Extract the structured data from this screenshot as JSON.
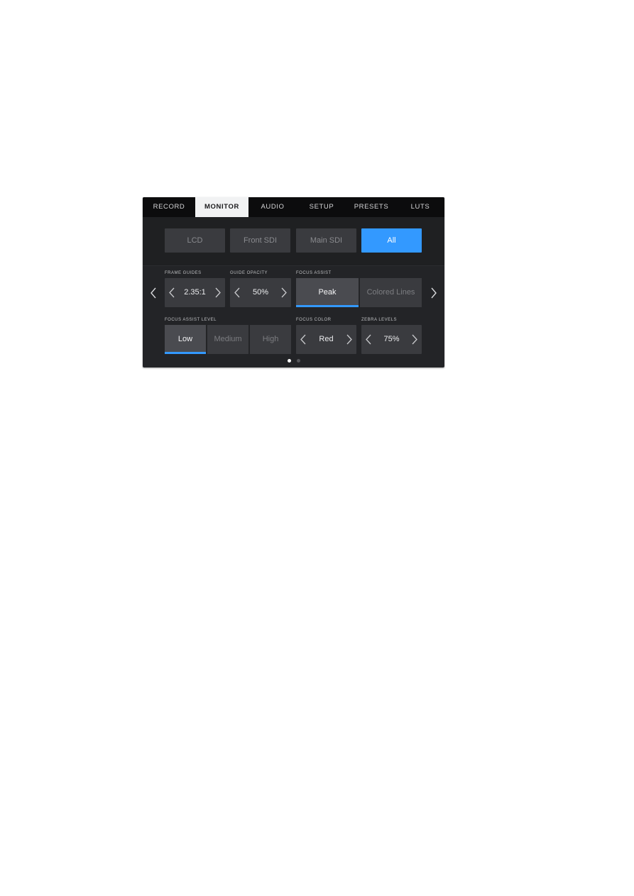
{
  "tabs": [
    {
      "label": "RECORD",
      "active": false
    },
    {
      "label": "MONITOR",
      "active": true
    },
    {
      "label": "AUDIO",
      "active": false
    },
    {
      "label": "SETUP",
      "active": false
    },
    {
      "label": "PRESETS",
      "active": false
    },
    {
      "label": "LUTS",
      "active": false
    }
  ],
  "outputs": [
    {
      "label": "LCD",
      "active": false
    },
    {
      "label": "Front SDI",
      "active": false
    },
    {
      "label": "Main SDI",
      "active": false
    },
    {
      "label": "All",
      "active": true
    }
  ],
  "settings": {
    "frame_guides": {
      "label": "FRAME GUIDES",
      "value": "2.35:1"
    },
    "guide_opacity": {
      "label": "GUIDE OPACITY",
      "value": "50%"
    },
    "focus_assist": {
      "label": "FOCUS ASSIST",
      "options": [
        "Peak",
        "Colored Lines"
      ],
      "selected": "Peak"
    },
    "focus_assist_level": {
      "label": "FOCUS ASSIST LEVEL",
      "options": [
        "Low",
        "Medium",
        "High"
      ],
      "selected": "Low"
    },
    "focus_color": {
      "label": "FOCUS COLOR",
      "value": "Red"
    },
    "zebra_levels": {
      "label": "ZEBRA LEVELS",
      "value": "75%"
    }
  },
  "pagination": {
    "current_page": 1,
    "total_pages": 2
  },
  "icons": {
    "prev_page": "chevron-left-icon",
    "next_page": "chevron-right-icon",
    "decrement": "chevron-left-icon",
    "increment": "chevron-right-icon"
  },
  "colors": {
    "accent": "#3399ff",
    "panel_bg": "#232427",
    "tabbar_bg": "#0c0c0d",
    "active_tab_bg": "#f1f2f3",
    "button_bg": "#3a3b3f",
    "selected_option_bg": "#4a4b50"
  }
}
